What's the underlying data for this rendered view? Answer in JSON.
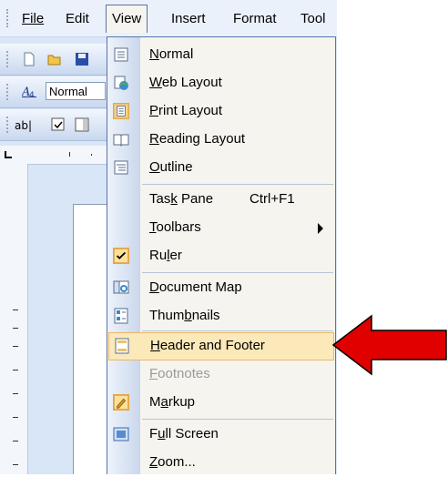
{
  "menubar": {
    "items": [
      "File",
      "Edit",
      "View",
      "Insert",
      "Format",
      "Tool"
    ],
    "active": "View"
  },
  "toolbar": {
    "style_value": "Normal"
  },
  "view_menu": {
    "items": [
      {
        "label": "Normal",
        "key": "N",
        "icon": "normal-view-icon"
      },
      {
        "label": "Web Layout",
        "key": "W",
        "icon": "web-layout-icon"
      },
      {
        "label": "Print Layout",
        "key": "P",
        "icon": "print-layout-icon",
        "checked": true
      },
      {
        "label": "Reading Layout",
        "key": "R",
        "icon": "reading-layout-icon"
      },
      {
        "label": "Outline",
        "key": "O",
        "icon": "outline-icon"
      },
      {
        "label": "Task Pane",
        "key": "k",
        "shortcut": "Ctrl+F1"
      },
      {
        "label": "Toolbars",
        "key": "T",
        "submenu": true
      },
      {
        "label": "Ruler",
        "key": "l",
        "icon": "checkmark-icon",
        "checked": true
      },
      {
        "label": "Document Map",
        "key": "D",
        "icon": "document-map-icon"
      },
      {
        "label": "Thumbnails",
        "key": "b",
        "icon": "thumbnails-icon"
      },
      {
        "label": "Header and Footer",
        "key": "H",
        "icon": "header-footer-icon",
        "highlighted": true
      },
      {
        "label": "Footnotes",
        "key": "F",
        "disabled": true
      },
      {
        "label": "Markup",
        "key": "a",
        "icon": "markup-icon",
        "checked": true
      },
      {
        "label": "Full Screen",
        "key": "u",
        "icon": "full-screen-icon"
      },
      {
        "label": "Zoom...",
        "key": "Z"
      }
    ]
  },
  "colors": {
    "highlight_fill": "#fbe9b9",
    "arrow": "#e00000"
  }
}
